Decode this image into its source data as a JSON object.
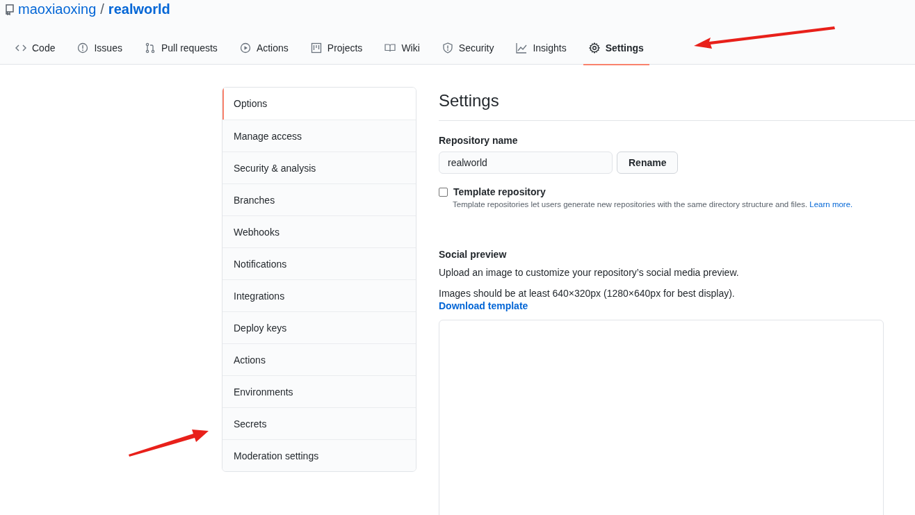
{
  "repo": {
    "owner": "maoxiaoxing",
    "separator": "/",
    "name": "realworld"
  },
  "tabs": [
    {
      "label": "Code",
      "kind": "code",
      "selected": false
    },
    {
      "label": "Issues",
      "kind": "issues",
      "selected": false
    },
    {
      "label": "Pull requests",
      "kind": "pulls",
      "selected": false
    },
    {
      "label": "Actions",
      "kind": "actions",
      "selected": false
    },
    {
      "label": "Projects",
      "kind": "projects",
      "selected": false
    },
    {
      "label": "Wiki",
      "kind": "wiki",
      "selected": false
    },
    {
      "label": "Security",
      "kind": "security",
      "selected": false
    },
    {
      "label": "Insights",
      "kind": "insights",
      "selected": false
    },
    {
      "label": "Settings",
      "kind": "settings",
      "selected": true
    }
  ],
  "sidebar": {
    "items": [
      {
        "label": "Options",
        "selected": true
      },
      {
        "label": "Manage access",
        "selected": false
      },
      {
        "label": "Security & analysis",
        "selected": false
      },
      {
        "label": "Branches",
        "selected": false
      },
      {
        "label": "Webhooks",
        "selected": false
      },
      {
        "label": "Notifications",
        "selected": false
      },
      {
        "label": "Integrations",
        "selected": false
      },
      {
        "label": "Deploy keys",
        "selected": false
      },
      {
        "label": "Actions",
        "selected": false
      },
      {
        "label": "Environments",
        "selected": false
      },
      {
        "label": "Secrets",
        "selected": false
      },
      {
        "label": "Moderation settings",
        "selected": false
      }
    ]
  },
  "settings": {
    "title": "Settings",
    "repository_name": {
      "label": "Repository name",
      "value": "realworld",
      "button": "Rename"
    },
    "template": {
      "label": "Template repository",
      "checked": false,
      "description": "Template repositories let users generate new repositories with the same directory structure and files.",
      "link": "Learn more."
    },
    "social_preview": {
      "title": "Social preview",
      "description": "Upload an image to customize your repository’s social media preview.",
      "size_note": "Images should be at least 640×320px (1280×640px for best display).",
      "link": "Download template"
    }
  }
}
